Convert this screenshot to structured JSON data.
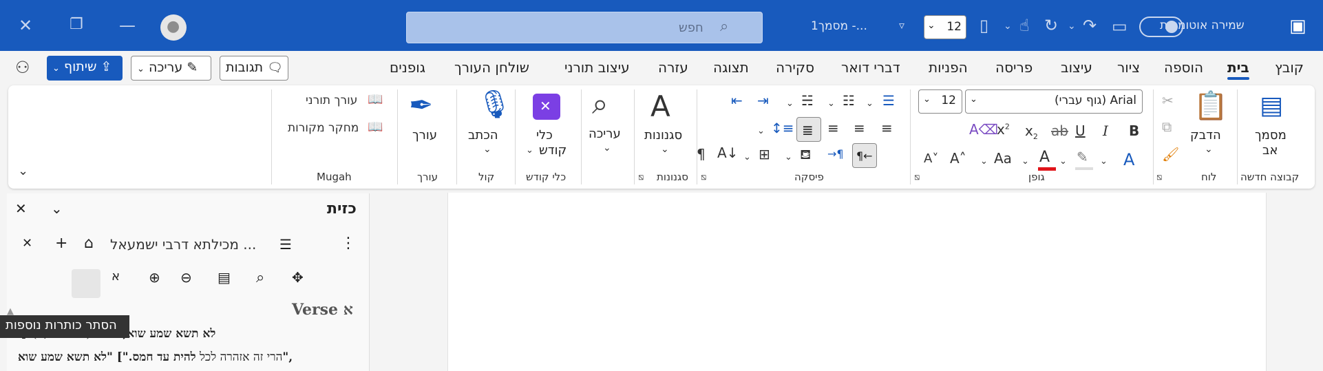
{
  "title_bar": {
    "autosave_label": "שמירה אוטומטית",
    "doc_title": "מסמך1 -...",
    "font_size": "12",
    "search_placeholder": "חפש"
  },
  "menu_tabs": [
    "קובץ",
    "בית",
    "הוספה",
    "ציור",
    "עיצוב",
    "פריסה",
    "הפניות",
    "דברי דואר",
    "סקירה",
    "תצוגה",
    "עזרה",
    "עיצוב תורני",
    "שולחן העורך",
    "גופנים"
  ],
  "actions": {
    "comments": "תגובות",
    "editing": "עריכה",
    "share": "שיתוף"
  },
  "ribbon": {
    "new_group": {
      "btn_line1": "מסמך",
      "btn_line2": "אב",
      "label": "קבוצה חדשה"
    },
    "clipboard": {
      "paste": "הדבק",
      "label": "לוח"
    },
    "font": {
      "name": "(גוף עברי) Arial",
      "size": "12",
      "label": "גופן",
      "aa": "Aa"
    },
    "paragraph": {
      "label": "פיסקה"
    },
    "styles": {
      "btn": "סגנונות",
      "label": "סגנונות"
    },
    "editing": {
      "btn": "עריכה"
    },
    "kodesh": {
      "btn_line1": "כלי",
      "btn_line2": "קודש",
      "label": "כלי קודש"
    },
    "voice": {
      "btn": "הכתב",
      "label": "קול"
    },
    "editor": {
      "btn": "עורך",
      "label": "עורך"
    },
    "mugah": {
      "item1": "עורך תורני",
      "item2": "מחקר מקורות",
      "label": "Mugah"
    }
  },
  "panel": {
    "title": "כזית",
    "tab_title": "מכילתא דרבי ישמעאל ...",
    "verse_heading": "Verse א",
    "line1_ref": "(שמות כג,א)",
    "line1_bold": "[\"לא תשא שמע שוא, אל ת",
    "line2_bold": "להית עד חמס.\"] \"לא תשא שמע שוא\",",
    "line2_rest": "הרי זה אזהרה לכל",
    "tooltip": "הסתר כותרות נוספות"
  }
}
